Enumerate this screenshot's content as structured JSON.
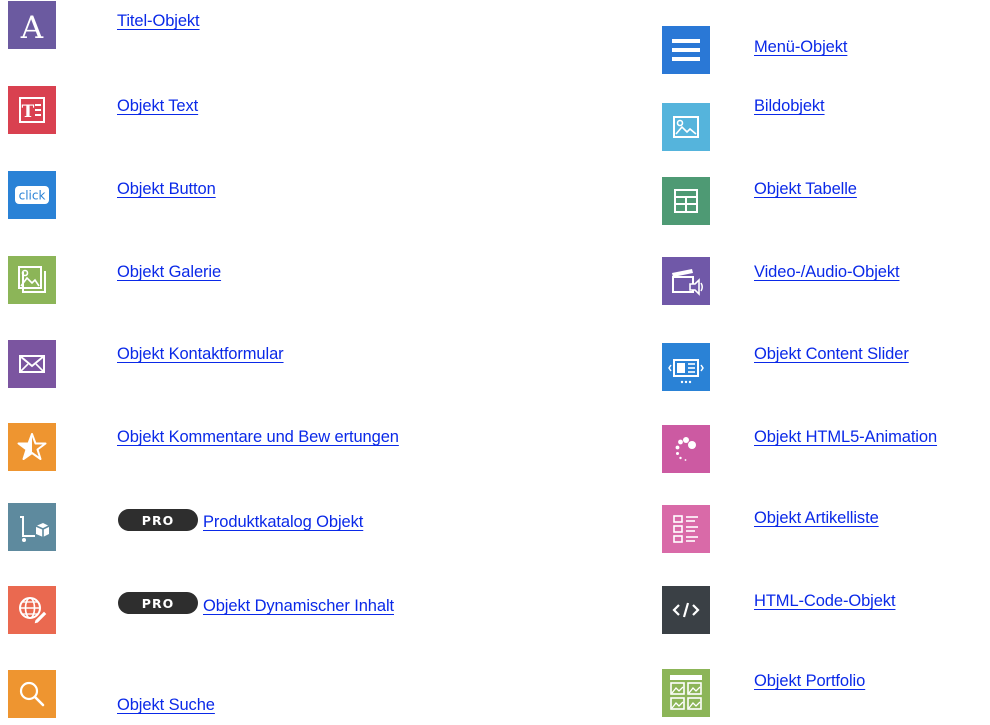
{
  "left_column": [
    {
      "label": "Titel-Objekt",
      "icon": "title-icon",
      "color": "#6b5aa0"
    },
    {
      "label": "Objekt Text",
      "icon": "text-icon",
      "color": "#d94150"
    },
    {
      "label": "Objekt Button",
      "icon": "click-icon",
      "color": "#2a82d6"
    },
    {
      "label": "Objekt Galerie",
      "icon": "gallery-icon",
      "color": "#8cb558"
    },
    {
      "label": "Objekt Kontaktformular",
      "icon": "envelope-icon",
      "color": "#7b55a0"
    },
    {
      "label": "Objekt Kommentare und Bew ertungen",
      "icon": "star-icon",
      "color": "#ee9530"
    },
    {
      "label": "Produktkatalog Objekt",
      "icon": "cart-icon",
      "color": "#5e8a9e",
      "badge": "PRO"
    },
    {
      "label": "Objekt Dynamischer Inhalt",
      "icon": "globe-pencil-icon",
      "color": "#ea6950",
      "badge": "PRO"
    },
    {
      "label": "Objekt Suche",
      "icon": "search-icon",
      "color": "#ee9530"
    }
  ],
  "right_column": [
    {
      "label": "Menü-Objekt",
      "icon": "menu-icon",
      "color": "#2a78d6"
    },
    {
      "label": "Bildobjekt",
      "icon": "image-icon",
      "color": "#55b4dc"
    },
    {
      "label": "Objekt Tabelle",
      "icon": "table-icon",
      "color": "#4e9a74"
    },
    {
      "label": "Video-/Audio-Objekt",
      "icon": "video-audio-icon",
      "color": "#7058a8"
    },
    {
      "label": "Objekt Content Slider",
      "icon": "slider-icon",
      "color": "#2a82d6"
    },
    {
      "label": "Objekt HTML5-Animation",
      "icon": "animation-icon",
      "color": "#cc5aa2"
    },
    {
      "label": "Objekt Artikelliste",
      "icon": "article-list-icon",
      "color": "#d96aa8"
    },
    {
      "label": "HTML-Code-Objekt",
      "icon": "code-icon",
      "color": "#3a4045"
    },
    {
      "label": "Objekt Portfolio",
      "icon": "portfolio-icon",
      "color": "#8cb558"
    }
  ]
}
